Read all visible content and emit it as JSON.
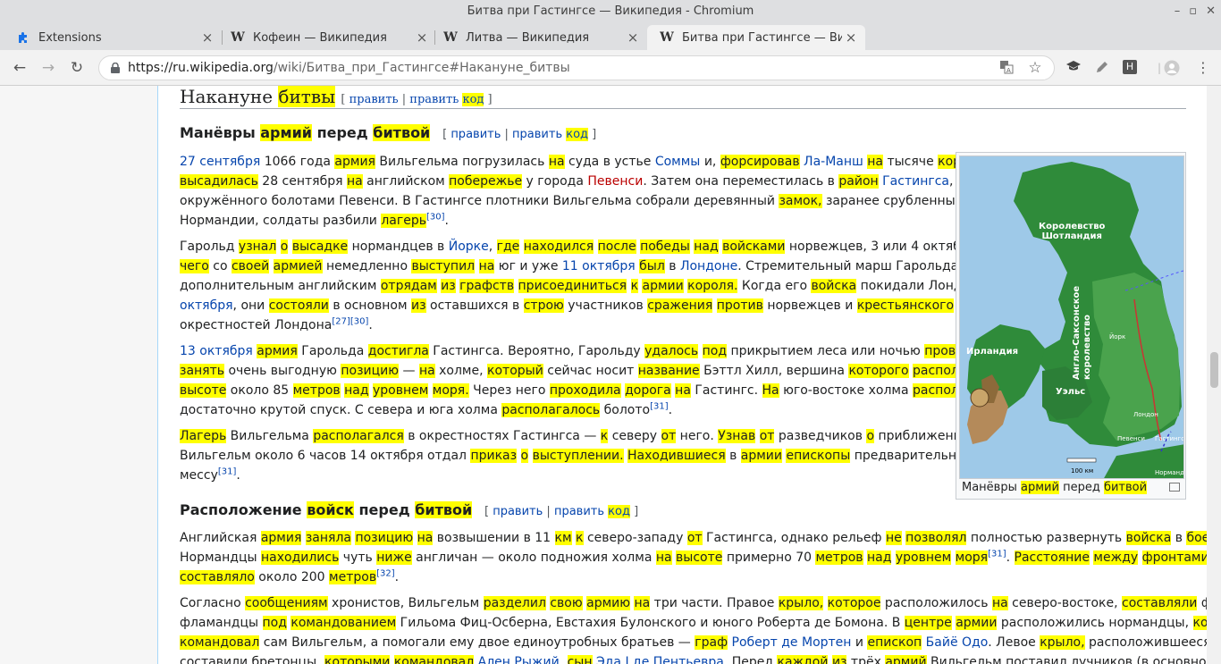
{
  "window": {
    "title": "Битва при Гастингсе — Википедия - Chromium"
  },
  "tabs": [
    {
      "label": "Extensions",
      "close": "×"
    },
    {
      "label": "Кофеин — Википедия",
      "close": "×"
    },
    {
      "label": "Литва — Википедия",
      "close": "×"
    },
    {
      "label": "Битва при Гастингсе — Википедия",
      "close": "×"
    }
  ],
  "toolbar": {
    "url_host": "https://ru.wikipedia.org",
    "url_path": "/wiki/Битва_при_Гастингсе#Накануне_битвы",
    "ext_h": "H"
  },
  "article": {
    "edit": "править",
    "edit_code_a": "править",
    "edit_code_b": "код",
    "sep": "|",
    "h2": {
      "a": "Накануне ",
      "b": "битвы"
    },
    "h3a": {
      "a": "Манёвры ",
      "b": "армий",
      "c": " перед ",
      "d": "битвой"
    },
    "h3b": {
      "a": "Расположение ",
      "b": "войск",
      "c": " перед ",
      "d": "битвой"
    },
    "figure": {
      "caption_a": "Манёвры ",
      "caption_b": "армий",
      "caption_c": " перед ",
      "caption_d": "битвой",
      "labels": {
        "scotland1": "Королевство",
        "scotland2": "Шотландия",
        "ireland": "Ирландия",
        "wales": "Уэльс",
        "anglo1": "Англо-Саксонское",
        "anglo2": "королевство",
        "london": "Лондон",
        "york": "Йорк",
        "pevensey": "Певенси",
        "hastings": "Гастингс",
        "normandy": "Нормандия",
        "scale": "100 км"
      }
    }
  }
}
